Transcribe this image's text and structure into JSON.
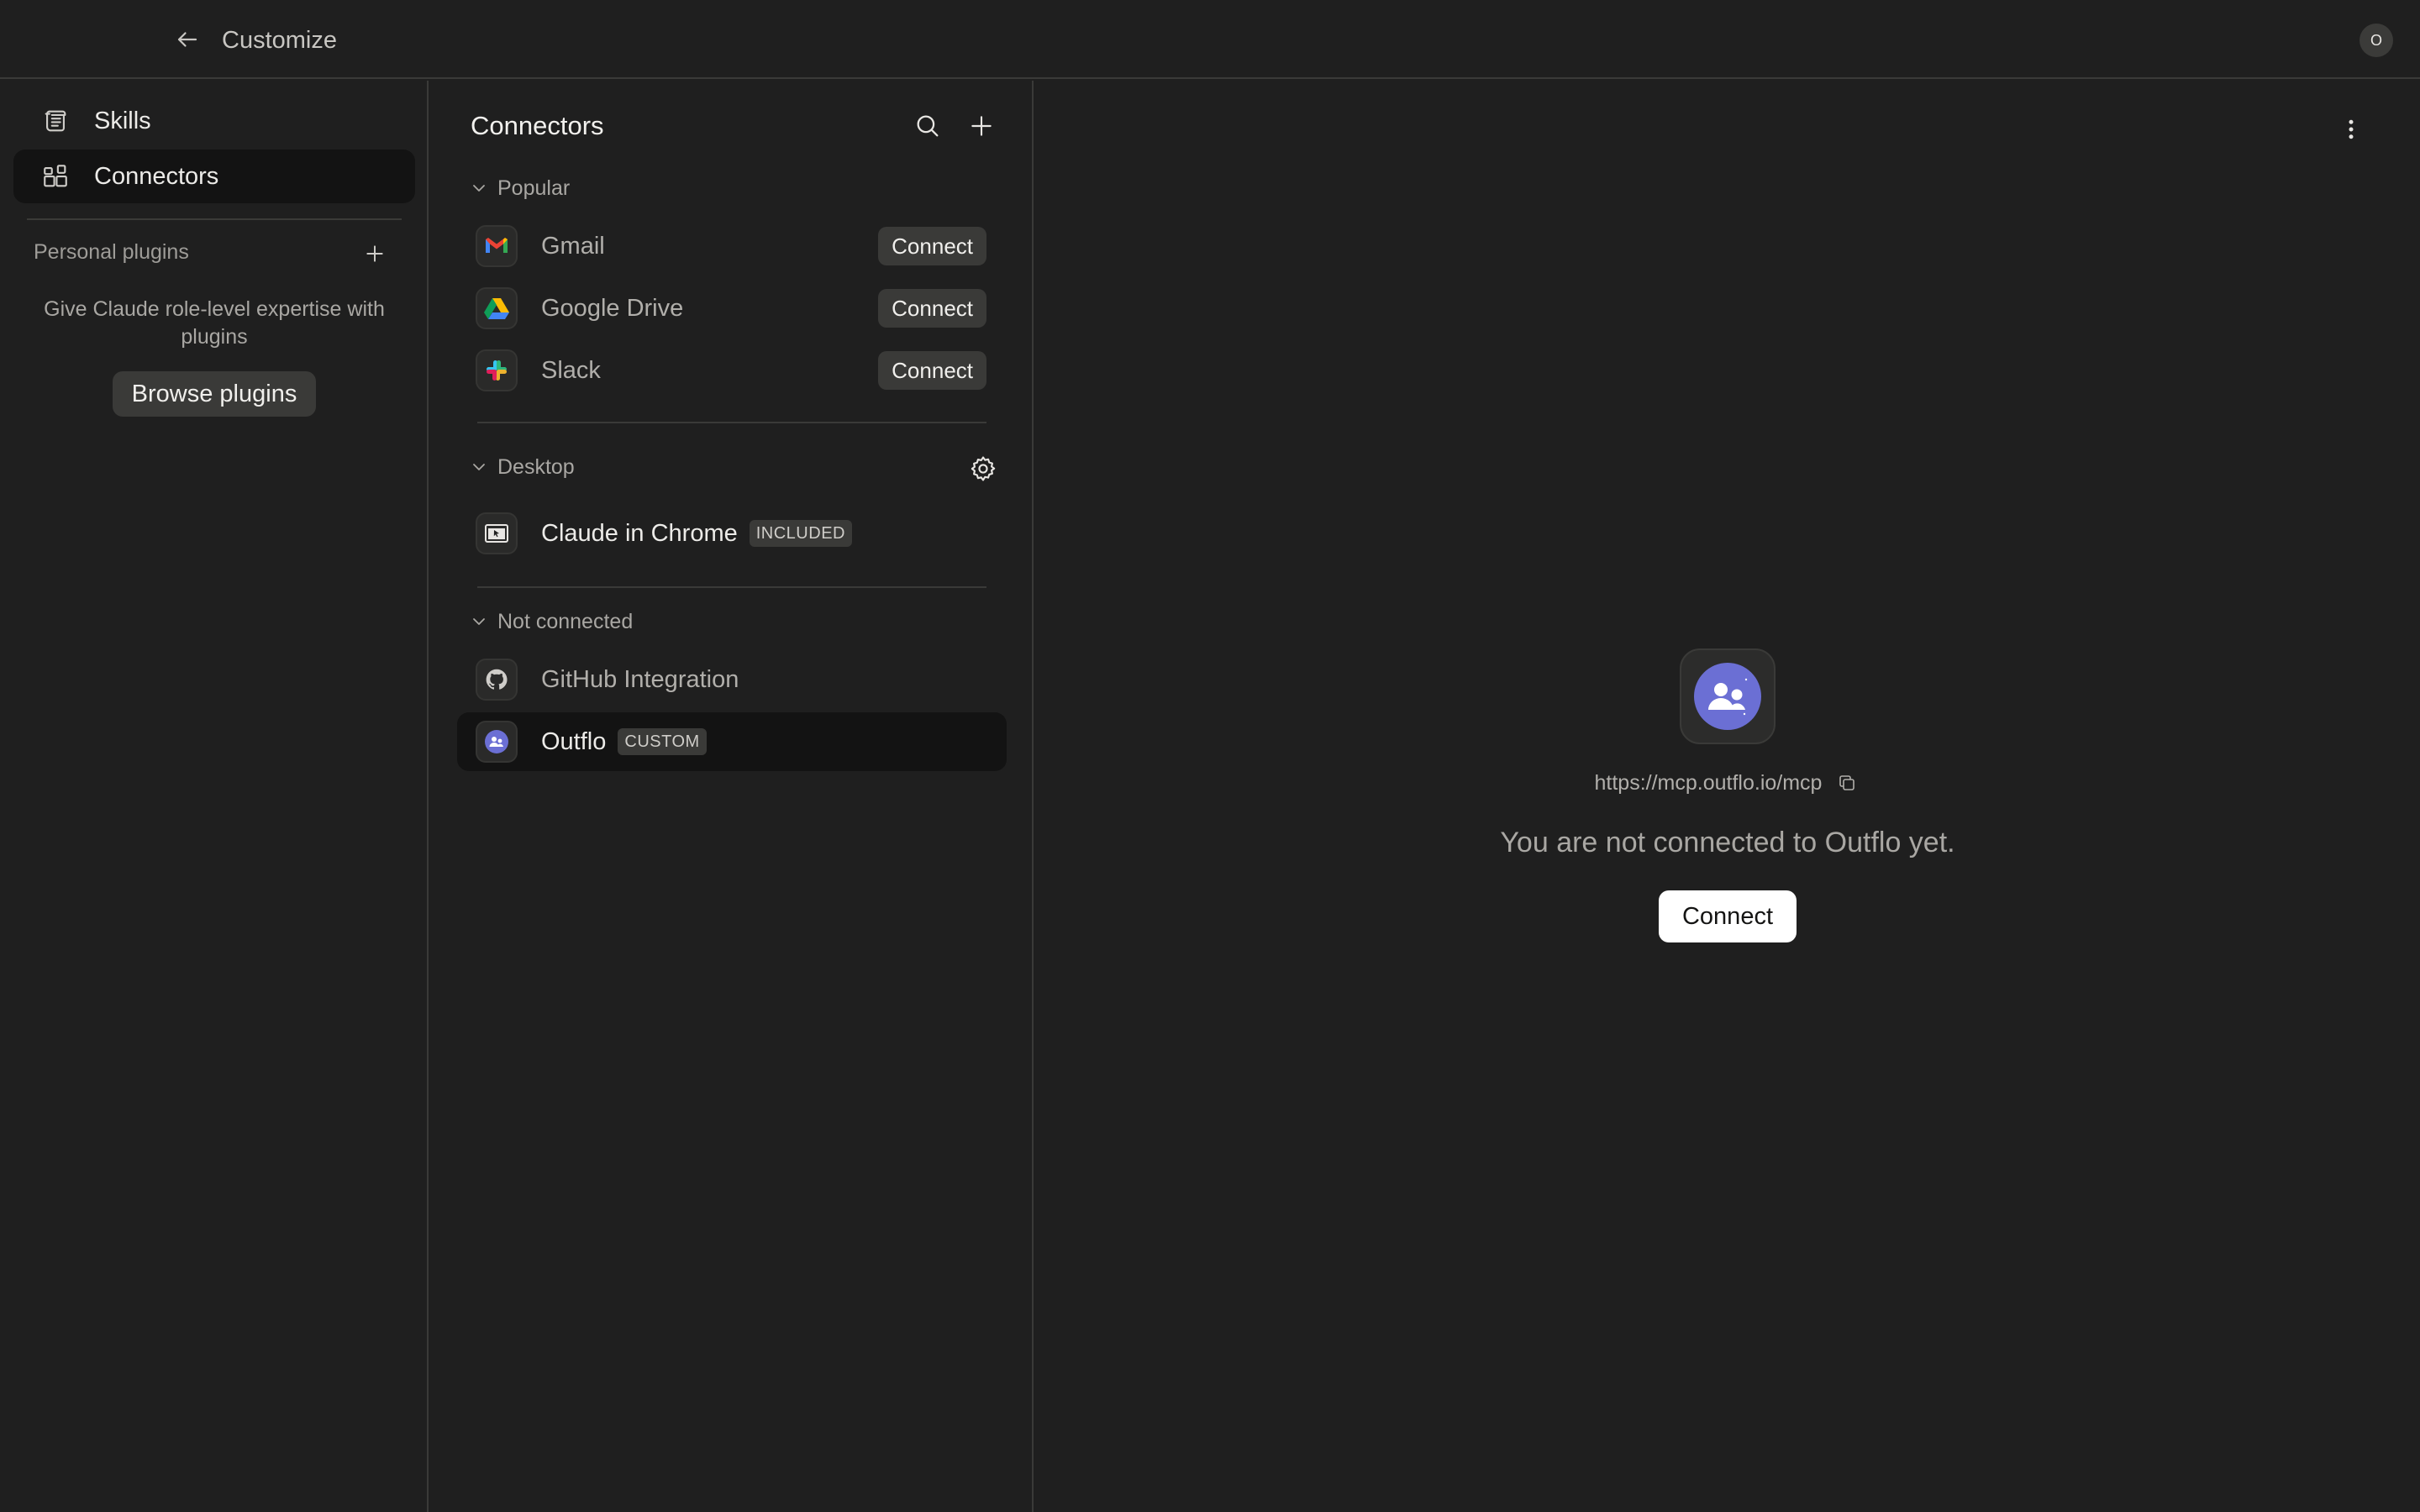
{
  "topbar": {
    "title": "Customize",
    "avatar_initial": "O"
  },
  "sidebar": {
    "items": [
      {
        "label": "Skills",
        "icon": "skills-icon",
        "active": false
      },
      {
        "label": "Connectors",
        "icon": "connectors-icon",
        "active": true
      }
    ],
    "plugins_heading": "Personal plugins",
    "plugins_description": "Give Claude role-level expertise with plugins",
    "browse_label": "Browse plugins"
  },
  "connectors": {
    "title": "Connectors",
    "sections": {
      "popular": {
        "label": "Popular",
        "items": [
          {
            "name": "Gmail",
            "action": "Connect",
            "icon": "gmail-icon"
          },
          {
            "name": "Google Drive",
            "action": "Connect",
            "icon": "google-drive-icon"
          },
          {
            "name": "Slack",
            "action": "Connect",
            "icon": "slack-icon"
          }
        ]
      },
      "desktop": {
        "label": "Desktop",
        "items": [
          {
            "name": "Claude in Chrome",
            "tag": "INCLUDED",
            "icon": "chrome-extension-icon"
          }
        ]
      },
      "not_connected": {
        "label": "Not connected",
        "items": [
          {
            "name": "GitHub Integration",
            "icon": "github-icon"
          },
          {
            "name": "Outflo",
            "tag": "CUSTOM",
            "icon": "outflo-icon",
            "selected": true
          }
        ]
      }
    }
  },
  "detail": {
    "url": "https://mcp.outflo.io/mcp",
    "message": "You are not connected to Outflo yet.",
    "connect_label": "Connect",
    "logo_color": "#6b6fd4"
  }
}
